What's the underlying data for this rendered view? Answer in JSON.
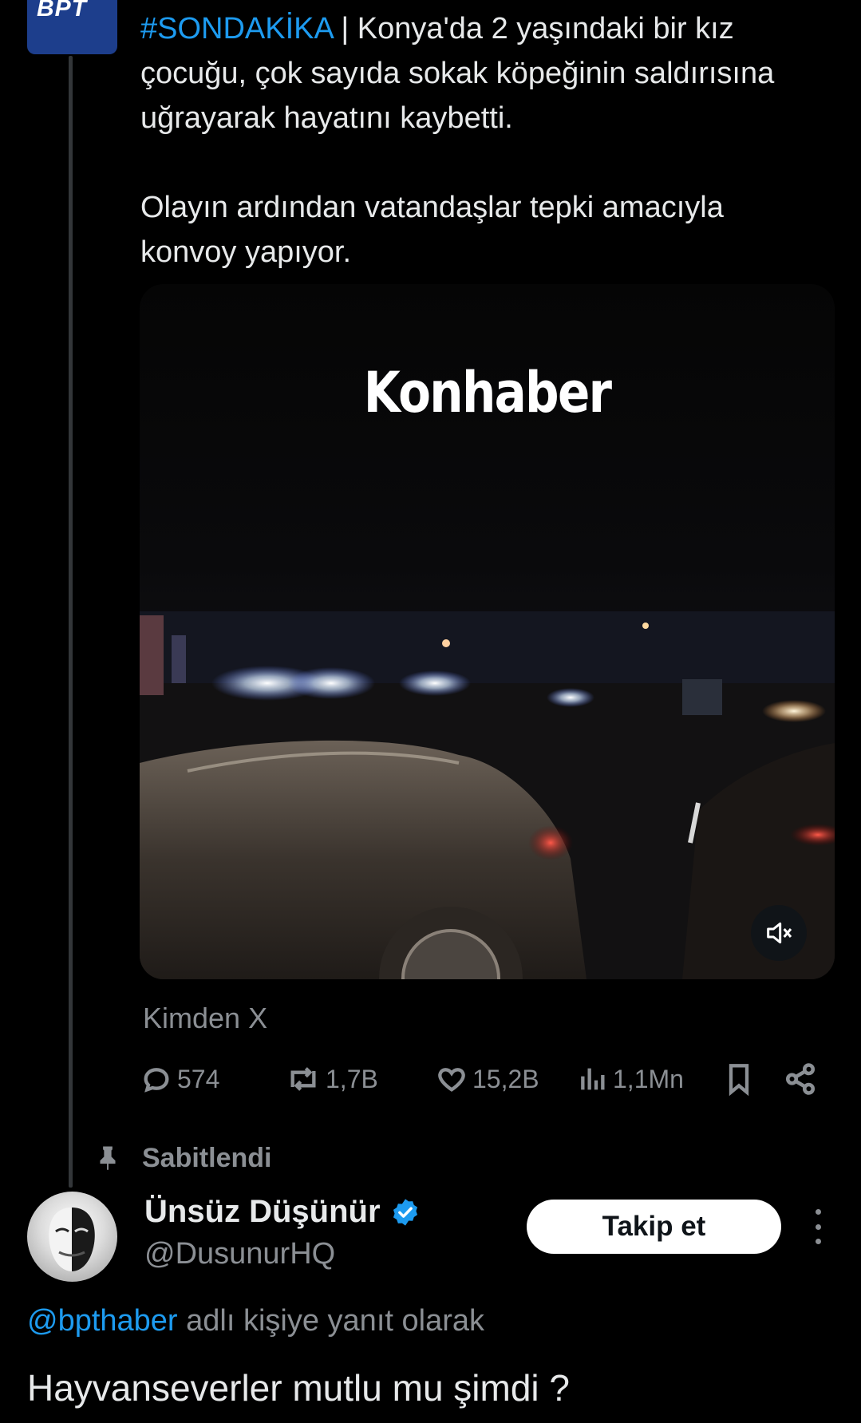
{
  "tweet": {
    "author_avatar_text": "BPT",
    "hashtag": "#SONDAKİKA",
    "text_line1": " | Konya'da 2 yaşındaki bir kız çocuğu, çok sayıda sokak köpeğinin saldırısına uğrayarak hayatını kaybetti.",
    "text_line2": "Olayın ardından vatandaşlar tepki amacıyla konvoy yapıyor.",
    "video_watermark": "Konhaber",
    "source": "Kimden X",
    "stats": {
      "replies": "574",
      "reposts": "1,7B",
      "likes": "15,2B",
      "views": "1,1Mn"
    }
  },
  "reply": {
    "pinned_label": "Sabitlendi",
    "name": "Ünsüz Düşünür",
    "handle": "@DusunurHQ",
    "follow_label": "Takip et",
    "replying_mention": "@bpthaber",
    "replying_suffix": " adlı kişiye yanıt olarak",
    "text": "Hayvanseverler mutlu mu şimdi ?"
  },
  "colors": {
    "background": "#000000",
    "link": "#1d9bf0",
    "muted": "#8b8f94",
    "verified": "#1d9bf0"
  }
}
